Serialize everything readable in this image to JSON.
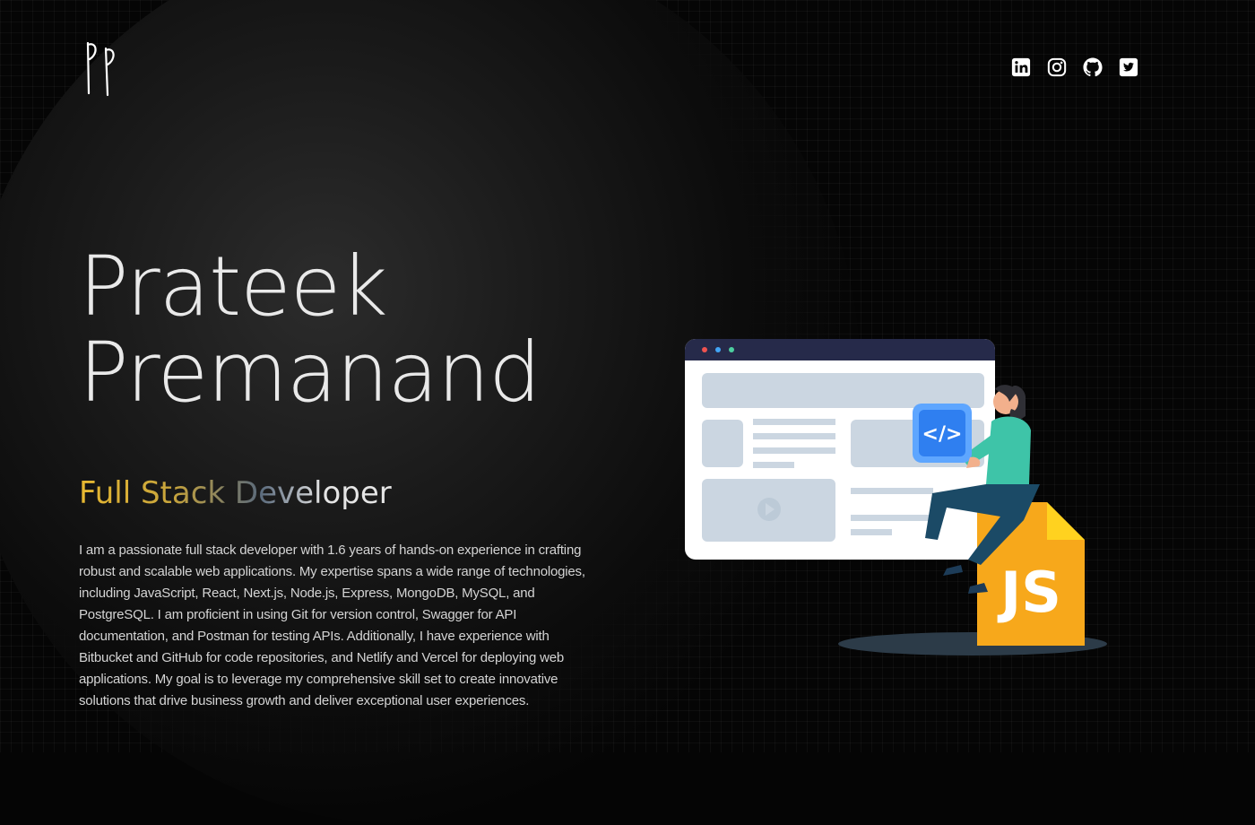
{
  "header": {
    "logo_text": "PP",
    "socials": [
      {
        "icon": "linkedin-icon"
      },
      {
        "icon": "instagram-icon"
      },
      {
        "icon": "github-icon"
      },
      {
        "icon": "twitter-icon"
      }
    ]
  },
  "hero": {
    "first_name": "Prateek",
    "last_name": "Premanand",
    "role": "Full Stack Developer",
    "bio": "I am a passionate full stack developer with 1.6 years of hands-on experience in crafting robust and scalable web applications. My expertise spans a wide range of technologies, including JavaScript, React, Next.js, Node.js, Express, MongoDB, MySQL, and PostgreSQL. I am proficient in using Git for version control, Swagger for API documentation, and Postman for testing APIs. Additionally, I have experience with Bitbucket and GitHub for code repositories, and Netlify and Vercel for deploying web applications. My goal is to leverage my comprehensive skill set to create innovative solutions that drive business growth and deliver exceptional user experiences."
  },
  "illustration": {
    "code_badge": "</>",
    "file_badge": "JS"
  },
  "colors": {
    "background": "#050505",
    "accent_gold": "#e8b931",
    "text": "#e9e9e9"
  }
}
